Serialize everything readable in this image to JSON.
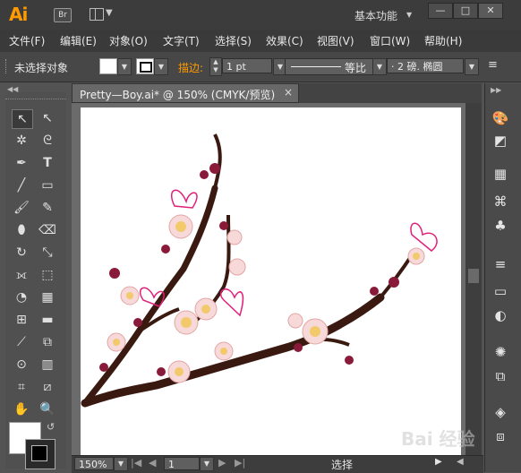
{
  "app": {
    "logo": "Ai",
    "bridge_label": "Br",
    "workspace": "基本功能"
  },
  "window_controls": {
    "minimize": "—",
    "maximize": "□",
    "close": "✕"
  },
  "menu": [
    "文件(F)",
    "编辑(E)",
    "对象(O)",
    "文字(T)",
    "选择(S)",
    "效果(C)",
    "视图(V)",
    "窗口(W)",
    "帮助(H)"
  ],
  "control_bar": {
    "selection_status": "未选择对象",
    "stroke_label": "描边:",
    "stroke_weight": "1 pt",
    "profile_label": "等比",
    "brush_label": "· 2 磅. 椭圆"
  },
  "document": {
    "tab_title": "Pretty—Boy.ai* @ 150% (CMYK/预览)",
    "close_icon": "×"
  },
  "status_bar": {
    "zoom": "150%",
    "artboard_number": "1",
    "tool_status": "选择"
  },
  "watermark": "Bai 经验",
  "colors": {
    "stroke_accent": "#e0207a",
    "blossom": "#f7d9d9",
    "branch": "#3a1a10",
    "ui_bg": "#535353"
  }
}
